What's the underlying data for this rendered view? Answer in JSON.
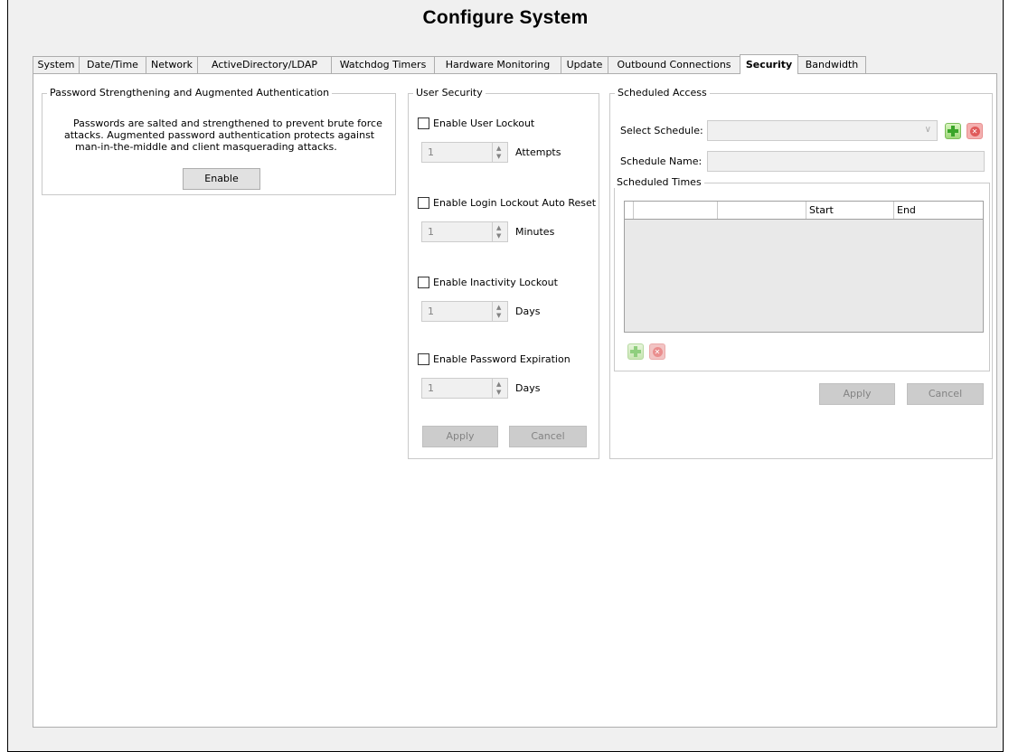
{
  "title": "Configure System",
  "tabs": [
    {
      "label": "System",
      "active": false
    },
    {
      "label": "Date/Time",
      "active": false
    },
    {
      "label": "Network",
      "active": false
    },
    {
      "label": "ActiveDirectory/LDAP",
      "active": false
    },
    {
      "label": "Watchdog Timers",
      "active": false
    },
    {
      "label": "Hardware Monitoring",
      "active": false
    },
    {
      "label": "Update",
      "active": false
    },
    {
      "label": "Outbound Connections",
      "active": false
    },
    {
      "label": "Security",
      "active": true
    },
    {
      "label": "Bandwidth",
      "active": false
    }
  ],
  "password_group": {
    "title": "Password Strengthening and Augmented Authentication",
    "lines": [
      "Passwords are salted and strengthened to prevent brute force",
      "attacks. Augmented password authentication protects against",
      "man-in-the-middle and client masquerading attacks."
    ],
    "enable_label": "Enable"
  },
  "user_security": {
    "title": "User Security",
    "items": [
      {
        "checkbox_label": "Enable User Lockout",
        "checked": false,
        "value": "1",
        "unit": "Attempts"
      },
      {
        "checkbox_label": "Enable Login Lockout Auto Reset",
        "checked": false,
        "value": "1",
        "unit": "Minutes"
      },
      {
        "checkbox_label": "Enable Inactivity Lockout",
        "checked": false,
        "value": "1",
        "unit": "Days"
      },
      {
        "checkbox_label": "Enable Password Expiration",
        "checked": false,
        "value": "1",
        "unit": "Days"
      }
    ],
    "apply_label": "Apply",
    "cancel_label": "Cancel"
  },
  "scheduled_access": {
    "title": "Scheduled Access",
    "select_schedule_label": "Select Schedule:",
    "selected_schedule": "",
    "schedule_name_label": "Schedule Name:",
    "schedule_name_value": "",
    "scheduled_times": {
      "title": "Scheduled Times",
      "columns": [
        "",
        "",
        "Start",
        "End"
      ],
      "rows": []
    },
    "apply_label": "Apply",
    "cancel_label": "Cancel"
  },
  "icons": {
    "add": "plus-icon",
    "remove": "delete-icon",
    "dropdown": "chevron-down-icon",
    "spin_up": "spin-up-icon",
    "spin_down": "spin-down-icon"
  },
  "colors": {
    "add_green": "#3aa52a",
    "remove_red": "#e05a5a"
  }
}
